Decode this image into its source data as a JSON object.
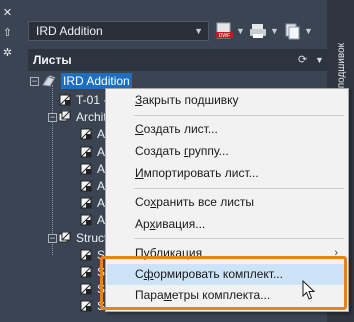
{
  "left_strip": {
    "icons": [
      "close-icon",
      "pin-icon",
      "settings-icon"
    ]
  },
  "toolbar": {
    "sheet_set_name": "IRD Addition",
    "buttons": [
      "dwf-publish-icon",
      "plot-icon",
      "sheet-set-manager-icon"
    ]
  },
  "sheets_panel": {
    "title": "Листы",
    "vertical_title": "Диспетчер подшивок"
  },
  "tree": {
    "root": "IRD Addition",
    "rows": [
      {
        "label": "T-01 -",
        "level": 1,
        "type": "sheet"
      },
      {
        "label": "Archit",
        "level": 1,
        "type": "group",
        "expanded": true
      },
      {
        "label": "A-",
        "level": 2,
        "type": "sheet"
      },
      {
        "label": "A-",
        "level": 2,
        "type": "sheet"
      },
      {
        "label": "A-",
        "level": 2,
        "type": "sheet"
      },
      {
        "label": "A-",
        "level": 2,
        "type": "sheet"
      },
      {
        "label": "A-",
        "level": 2,
        "type": "sheet"
      },
      {
        "label": "A-",
        "level": 2,
        "type": "sheet"
      },
      {
        "label": "Struct",
        "level": 1,
        "type": "group",
        "expanded": true
      },
      {
        "label": "S-",
        "level": 2,
        "type": "sheet"
      },
      {
        "label": "S-",
        "level": 2,
        "type": "sheet"
      },
      {
        "label": "S-",
        "level": 2,
        "type": "sheet"
      },
      {
        "label": "S-",
        "level": 2,
        "type": "sheet"
      }
    ]
  },
  "context_menu": {
    "items": [
      {
        "accel": "З",
        "rest": "акрыть подшивку"
      },
      {
        "accel": "С",
        "rest": "оздать лист..."
      },
      {
        "accel": "",
        "pre": "Создать ",
        "mid_accel": "г",
        "rest": "руппу..."
      },
      {
        "accel": "И",
        "rest": "мпортировать лист..."
      },
      {
        "accel": "",
        "pre": "Со",
        "mid_accel": "х",
        "rest": "ранить все листы"
      },
      {
        "accel": "",
        "pre": "Ар",
        "mid_accel": "х",
        "rest": "ивация..."
      },
      {
        "accel": "",
        "pre": "Пу",
        "mid_accel": "б",
        "rest": "ликация",
        "submenu": "›"
      },
      {
        "accel": "",
        "pre": "С",
        "mid_accel": "ф",
        "rest": "ормировать комплект..."
      },
      {
        "accel": "",
        "pre": "Пара",
        "mid_accel": "м",
        "rest": "етры комплекта..."
      }
    ]
  },
  "colors": {
    "panel_bg": "#3b4453",
    "selection": "#1f6fbf",
    "menu_highlight": "#cde3f7",
    "callout": "#e8821c"
  }
}
